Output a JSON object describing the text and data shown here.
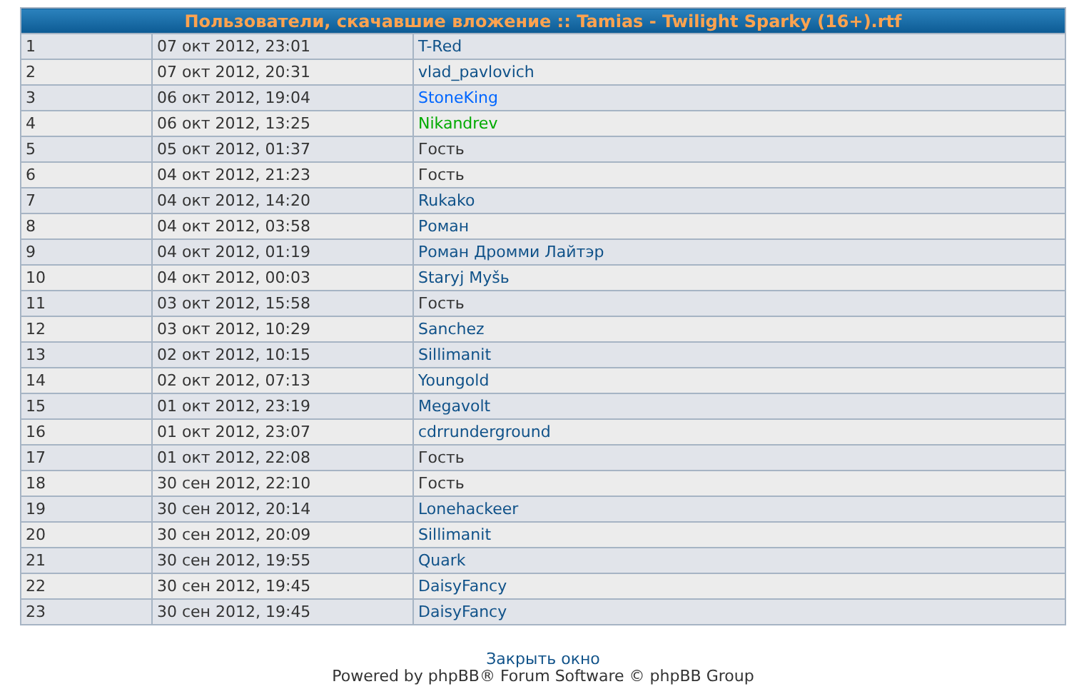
{
  "table": {
    "title": "Пользователи, скачавшие вложение :: Tamias - Twilight Sparky (16+).rtf",
    "rows": [
      {
        "number": "1",
        "date": "07 окт 2012, 23:01",
        "user": "T-Red",
        "kind": "user",
        "color": "#105289"
      },
      {
        "number": "2",
        "date": "07 окт 2012, 20:31",
        "user": "vlad_pavlovich",
        "kind": "user",
        "color": "#105289"
      },
      {
        "number": "3",
        "date": "06 окт 2012, 19:04",
        "user": "StoneKing",
        "kind": "user",
        "color": "#0066ff"
      },
      {
        "number": "4",
        "date": "06 окт 2012, 13:25",
        "user": "Nikandrev",
        "kind": "user",
        "color": "#00aa00"
      },
      {
        "number": "5",
        "date": "05 окт 2012, 01:37",
        "user": "Гость",
        "kind": "guest"
      },
      {
        "number": "6",
        "date": "04 окт 2012, 21:23",
        "user": "Гость",
        "kind": "guest"
      },
      {
        "number": "7",
        "date": "04 окт 2012, 14:20",
        "user": "Rukako",
        "kind": "user",
        "color": "#105289"
      },
      {
        "number": "8",
        "date": "04 окт 2012, 03:58",
        "user": "Роман",
        "kind": "user",
        "color": "#105289"
      },
      {
        "number": "9",
        "date": "04 окт 2012, 01:19",
        "user": "Роман Дромми Лайтэр",
        "kind": "user",
        "color": "#105289"
      },
      {
        "number": "10",
        "date": "04 окт 2012, 00:03",
        "user": "Staryj Myšь",
        "kind": "user",
        "color": "#105289"
      },
      {
        "number": "11",
        "date": "03 окт 2012, 15:58",
        "user": "Гость",
        "kind": "guest"
      },
      {
        "number": "12",
        "date": "03 окт 2012, 10:29",
        "user": "Sanchez",
        "kind": "user",
        "color": "#105289"
      },
      {
        "number": "13",
        "date": "02 окт 2012, 10:15",
        "user": "Sillimanit",
        "kind": "user",
        "color": "#105289"
      },
      {
        "number": "14",
        "date": "02 окт 2012, 07:13",
        "user": "Youngold",
        "kind": "user",
        "color": "#105289"
      },
      {
        "number": "15",
        "date": "01 окт 2012, 23:19",
        "user": "Megavolt",
        "kind": "user",
        "color": "#105289"
      },
      {
        "number": "16",
        "date": "01 окт 2012, 23:07",
        "user": "cdrrunderground",
        "kind": "user",
        "color": "#105289"
      },
      {
        "number": "17",
        "date": "01 окт 2012, 22:08",
        "user": "Гость",
        "kind": "guest"
      },
      {
        "number": "18",
        "date": "30 сен 2012, 22:10",
        "user": "Гость",
        "kind": "guest"
      },
      {
        "number": "19",
        "date": "30 сен 2012, 20:14",
        "user": "Lonehackeer",
        "kind": "user",
        "color": "#105289"
      },
      {
        "number": "20",
        "date": "30 сен 2012, 20:09",
        "user": "Sillimanit",
        "kind": "user",
        "color": "#105289"
      },
      {
        "number": "21",
        "date": "30 сен 2012, 19:55",
        "user": "Quark",
        "kind": "user",
        "color": "#105289"
      },
      {
        "number": "22",
        "date": "30 сен 2012, 19:45",
        "user": "DaisyFancy",
        "kind": "user",
        "color": "#105289"
      },
      {
        "number": "23",
        "date": "30 сен 2012, 19:45",
        "user": "DaisyFancy",
        "kind": "user",
        "color": "#105289"
      }
    ]
  },
  "footer": {
    "close_link": "Закрыть окно",
    "copyright": "Powered by phpBB® Forum Software © phpBB Group"
  }
}
